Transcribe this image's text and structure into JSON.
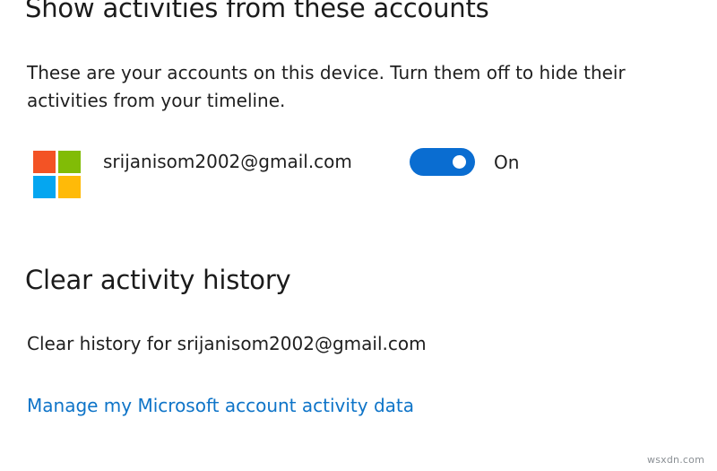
{
  "accounts_section": {
    "title": "Show activities from these accounts",
    "description": "These are your accounts on this device. Turn them off to hide their activities from your timeline.",
    "account": {
      "logo_icon": "microsoft-logo-icon",
      "email": "srijanisom2002@gmail.com",
      "toggle_state_label": "On",
      "toggle_on": true
    }
  },
  "clear_section": {
    "title": "Clear activity history",
    "clear_text": "Clear history for srijanisom2002@gmail.com",
    "manage_link": "Manage my Microsoft account activity data"
  },
  "watermark": "wsxdn.com",
  "colors": {
    "accent": "#0a6dd1",
    "link": "#0e74c8",
    "ms_red": "#f35325",
    "ms_green": "#81bc06",
    "ms_blue": "#05a6f0",
    "ms_yellow": "#ffba08"
  }
}
